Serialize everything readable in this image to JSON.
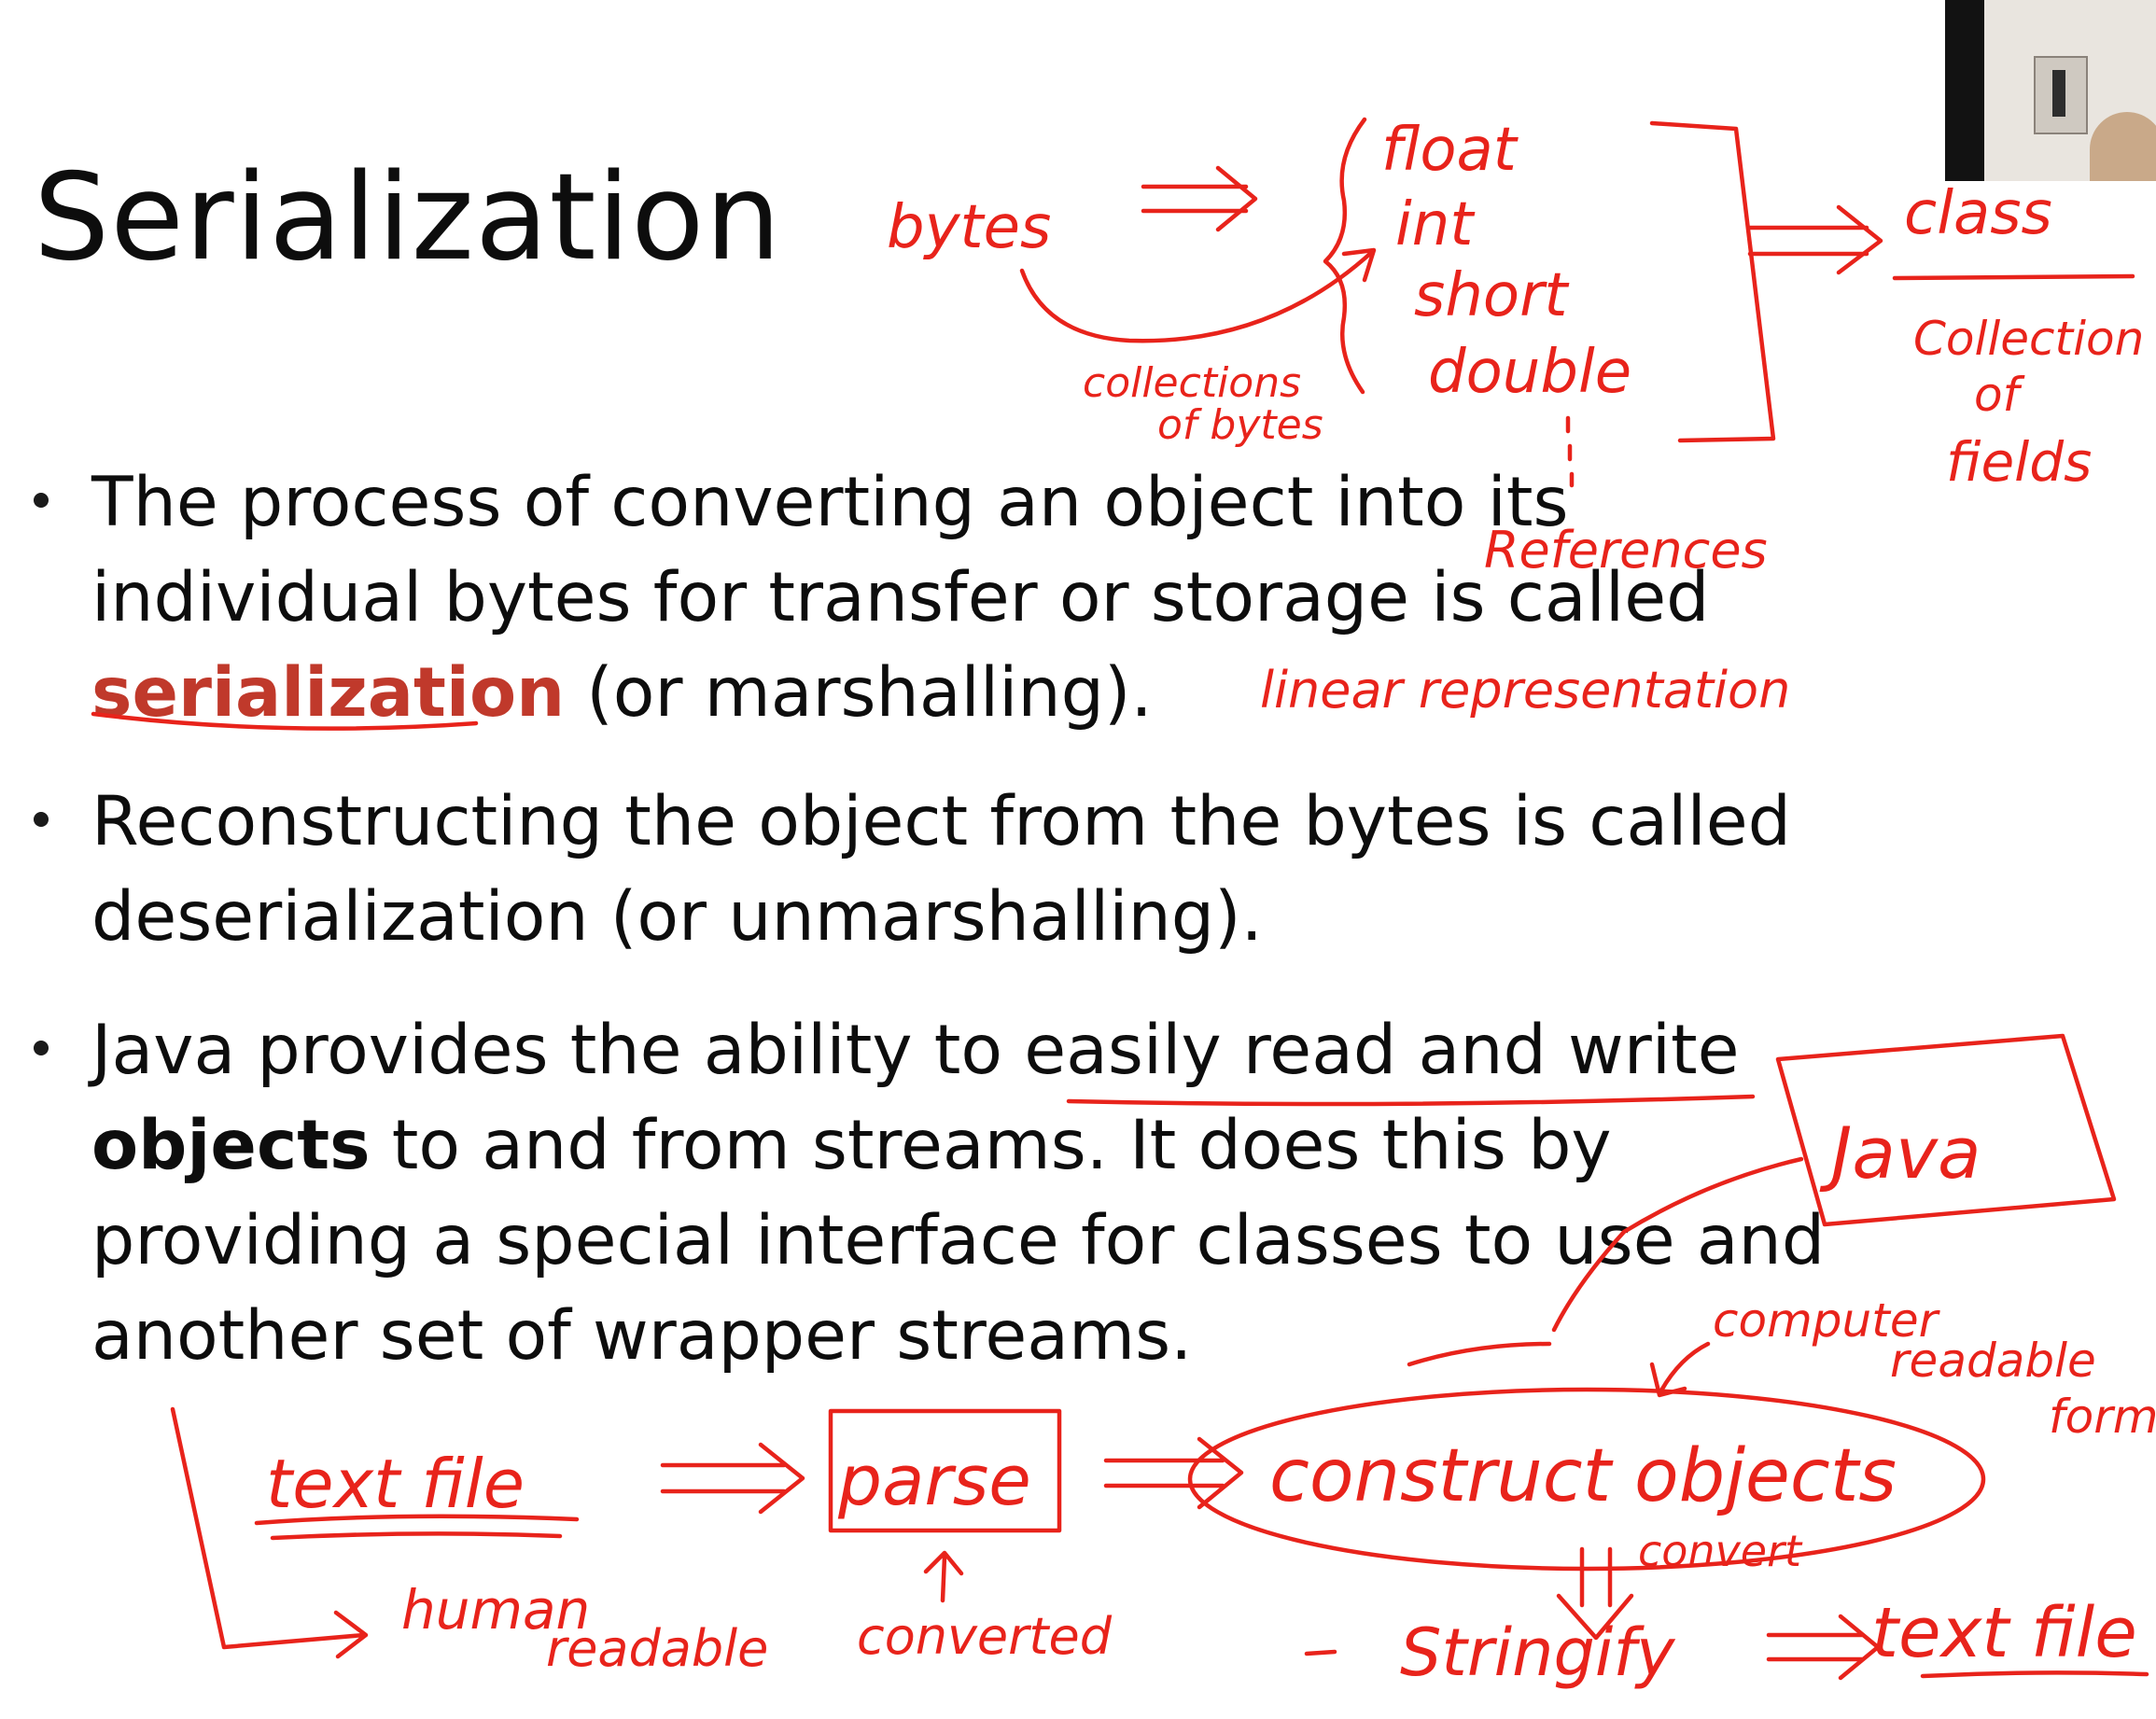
{
  "slide": {
    "title": "Serialization",
    "bullets": [
      {
        "before": "The process of converting an object into its\nindividual bytes for transfer or storage is called\n",
        "keyword": "serialization",
        "after": " (or marshalling)."
      },
      {
        "text": "Reconstructing the object from the bytes is called\ndeserialization (or unmarshalling)."
      },
      {
        "before": "Java provides the ability to easily read and write\n",
        "keyword": "objects",
        "after": " to and from streams.  It does this by\nproviding a special interface for classes to use and\nanother set of wrapper streams."
      }
    ]
  },
  "annotations": {
    "bytes": "bytes",
    "float": "float",
    "int": "int",
    "short": "short",
    "double": "double",
    "collections_of_bytes_1": "collections",
    "collections_of_bytes_2": "of bytes",
    "references": "References",
    "class": "class",
    "collection_of_fields_1": "Collection",
    "collection_of_fields_2": "of",
    "collection_of_fields_3": "fields",
    "linear_representation": "linear representation",
    "java": "Java",
    "computer_readable_1": "computer",
    "computer_readable_2": "readable",
    "computer_readable_3": "form",
    "text_file": "text file",
    "parse": "parse",
    "construct_objects": "construct objects",
    "convert": "convert",
    "human_readable_1": "human",
    "human_readable_2": "readable",
    "converted": "converted",
    "stringify": "Stringify",
    "text_file_2": "text file"
  },
  "colors": {
    "ink": "#e8231b",
    "keyword": "#c0392b",
    "text": "#0d0d0d"
  }
}
